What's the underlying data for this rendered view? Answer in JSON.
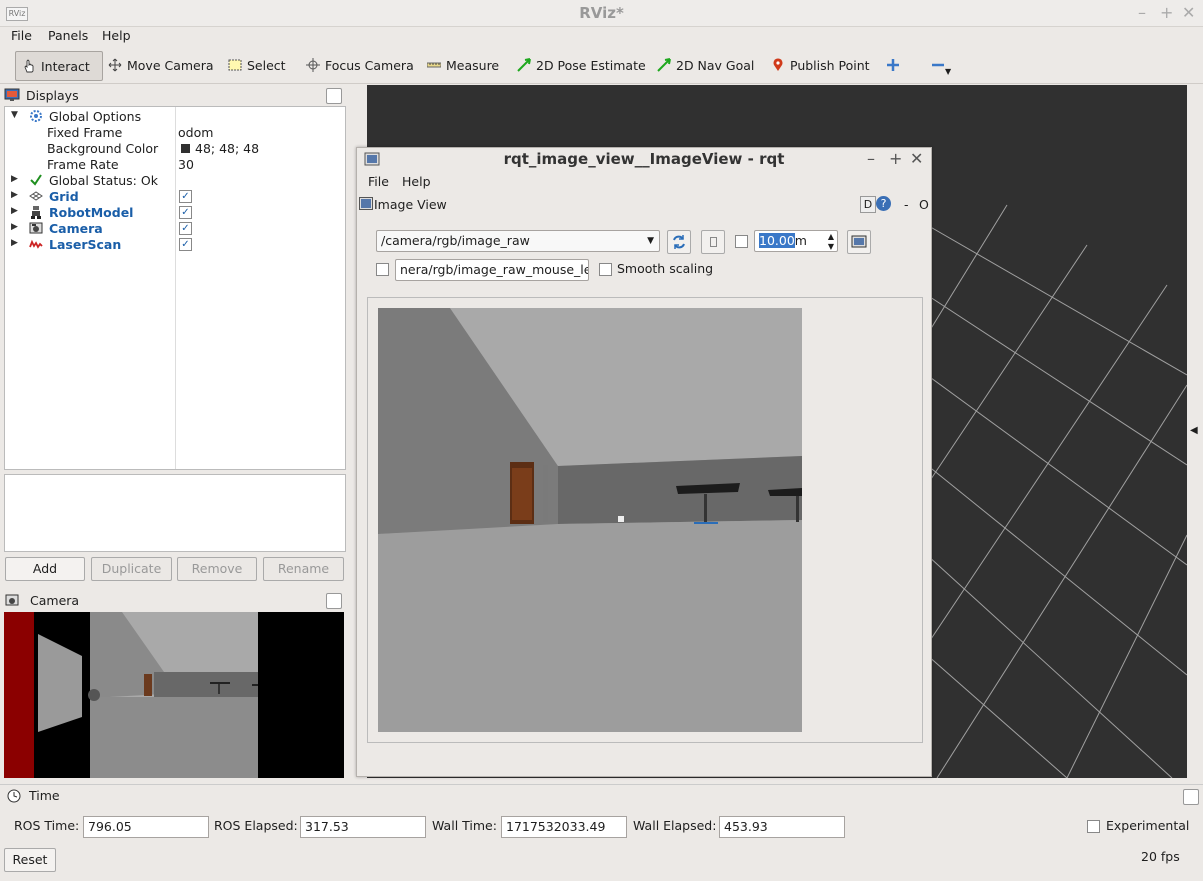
{
  "window": {
    "title": "RViz*",
    "app_icon": "rviz-icon"
  },
  "menu": [
    "File",
    "Panels",
    "Help"
  ],
  "toolbar": {
    "tools": [
      {
        "label": "Interact",
        "icon": "hand-icon"
      },
      {
        "label": "Move Camera",
        "icon": "move-icon"
      },
      {
        "label": "Select",
        "icon": "select-box-icon"
      },
      {
        "label": "Focus Camera",
        "icon": "crosshair-icon"
      },
      {
        "label": "Measure",
        "icon": "ruler-icon"
      },
      {
        "label": "2D Pose Estimate",
        "icon": "green-arrow-icon"
      },
      {
        "label": "2D Nav Goal",
        "icon": "green-arrow-icon"
      },
      {
        "label": "Publish Point",
        "icon": "map-pin-icon"
      }
    ]
  },
  "displays": {
    "title": "Displays",
    "rows": [
      {
        "label": "Global Options",
        "value": ""
      },
      {
        "label": "Fixed Frame",
        "value": "odom"
      },
      {
        "label": "Background Color",
        "value": "48; 48; 48"
      },
      {
        "label": "Frame Rate",
        "value": "30"
      },
      {
        "label": "Global Status: Ok",
        "value": ""
      },
      {
        "label": "Grid",
        "value": "✓"
      },
      {
        "label": "RobotModel",
        "value": "✓"
      },
      {
        "label": "Camera",
        "value": "✓"
      },
      {
        "label": "LaserScan",
        "value": "✓"
      }
    ],
    "buttons": {
      "add": "Add",
      "duplicate": "Duplicate",
      "remove": "Remove",
      "rename": "Rename"
    }
  },
  "camera_panel": {
    "title": "Camera"
  },
  "rqt": {
    "title": "rqt_image_view__ImageView - rqt",
    "menu": [
      "File",
      "Help"
    ],
    "plugin_title": "Image View",
    "plugin_controls": {
      "d": "D",
      "help": "?",
      "dash": "-",
      "o": "O"
    },
    "topic": "/camera/rgb/image_raw",
    "zoom_value": "10.00",
    "zoom_suffix": "m",
    "mouse_topic": "nera/rgb/image_raw_mouse_left",
    "smooth_scaling": "Smooth scaling"
  },
  "time": {
    "title": "Time",
    "ros_time_label": "ROS Time:",
    "ros_time": "796.05",
    "ros_elapsed_label": "ROS Elapsed:",
    "ros_elapsed": "317.53",
    "wall_time_label": "Wall Time:",
    "wall_time": "1717532033.49",
    "wall_elapsed_label": "Wall Elapsed:",
    "wall_elapsed": "453.93",
    "experimental": "Experimental",
    "reset": "Reset",
    "fps": "20 fps"
  },
  "colors": {
    "background": "#303030",
    "accent_blue": "#1a5ea8",
    "laser_red": "#cc2222",
    "green": "#22aa22"
  }
}
